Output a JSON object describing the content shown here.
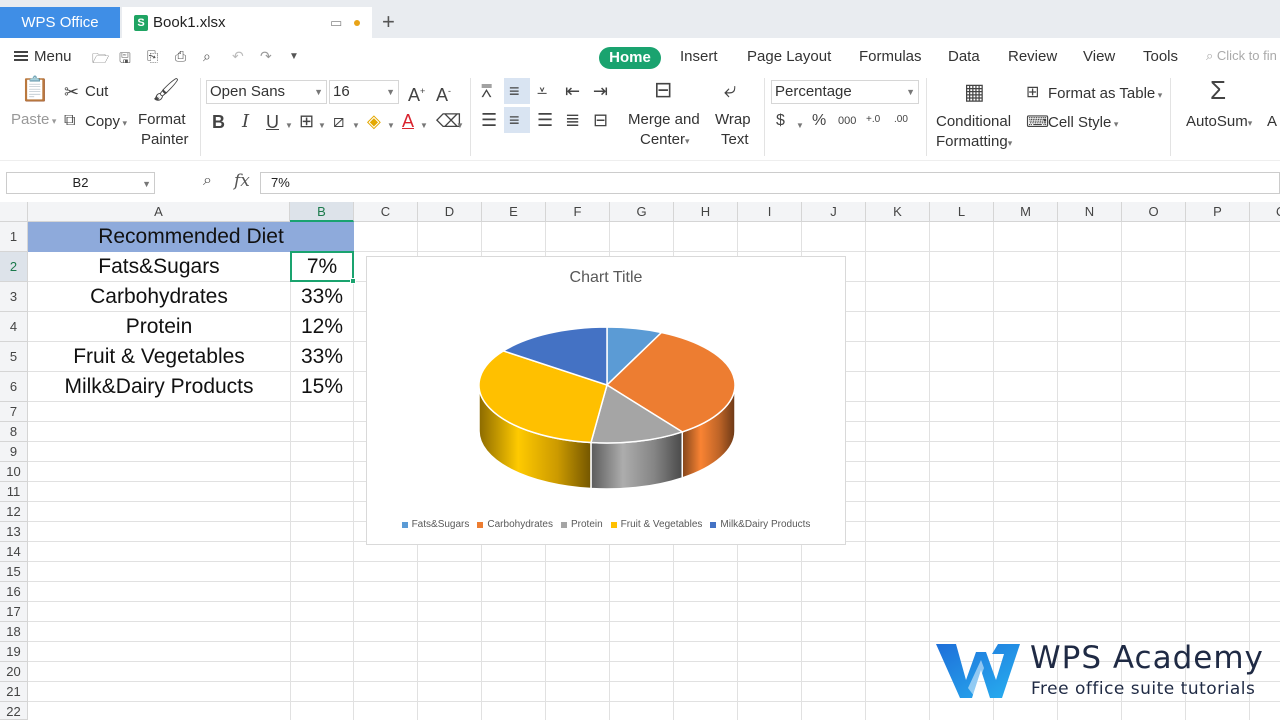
{
  "tabs": {
    "app_tab": "WPS Office",
    "doc_tab": "Book1.xlsx",
    "new_tab_symbol": "+"
  },
  "menu_bar": {
    "menu_label": "Menu",
    "tabs": [
      "Home",
      "Insert",
      "Page Layout",
      "Formulas",
      "Data",
      "Review",
      "View",
      "Tools"
    ],
    "active_tab": "Home",
    "search_placeholder": "Click to fin"
  },
  "ribbon": {
    "paste": "Paste",
    "cut": "Cut",
    "copy": "Copy",
    "format_painter_1": "Format",
    "format_painter_2": "Painter",
    "font_name": "Open Sans",
    "font_size": "16",
    "merge_center_1": "Merge and",
    "merge_center_2": "Center",
    "wrap_text_1": "Wrap",
    "wrap_text_2": "Text",
    "number_format": "Percentage",
    "conditional_formatting_1": "Conditional",
    "conditional_formatting_2": "Formatting",
    "format_as_table": "Format as Table",
    "cell_style": "Cell Style",
    "autosum": "AutoSum",
    "cut_off": "A"
  },
  "formula_bar": {
    "cell_ref": "B2",
    "fx_label": "fx",
    "value": "7%"
  },
  "columns": [
    "A",
    "B",
    "C",
    "D",
    "E",
    "F",
    "G",
    "H",
    "I",
    "J",
    "K",
    "L",
    "M",
    "N",
    "O",
    "P",
    "Q"
  ],
  "rows": [
    "1",
    "2",
    "3",
    "4",
    "5",
    "6",
    "7",
    "8",
    "9",
    "10",
    "11",
    "12",
    "13",
    "14",
    "15",
    "16",
    "17",
    "18",
    "19",
    "20",
    "21",
    "22"
  ],
  "sheet": {
    "title": "Recommended Diet",
    "items": [
      {
        "label": "Fats&Sugars",
        "value": "7%"
      },
      {
        "label": "Carbohydrates",
        "value": "33%"
      },
      {
        "label": "Protein",
        "value": "12%"
      },
      {
        "label": "Fruit & Vegetables",
        "value": "33%"
      },
      {
        "label": "Milk&Dairy Products",
        "value": "15%"
      }
    ],
    "title_fill_color": "#8eaadb",
    "selection_color": "#1aa36f"
  },
  "chart_data": {
    "type": "pie",
    "style": "3d",
    "title": "Chart Title",
    "categories": [
      "Fats&Sugars",
      "Carbohydrates",
      "Protein",
      "Fruit & Vegetables",
      "Milk&Dairy Products"
    ],
    "values": [
      7,
      33,
      12,
      33,
      15
    ],
    "colors": [
      "#5b9bd5",
      "#ed7d31",
      "#a5a5a5",
      "#ffc000",
      "#4472c4"
    ],
    "legend_position": "bottom"
  },
  "watermark": {
    "title": "WPS Academy",
    "subtitle": "Free office suite tutorials"
  }
}
